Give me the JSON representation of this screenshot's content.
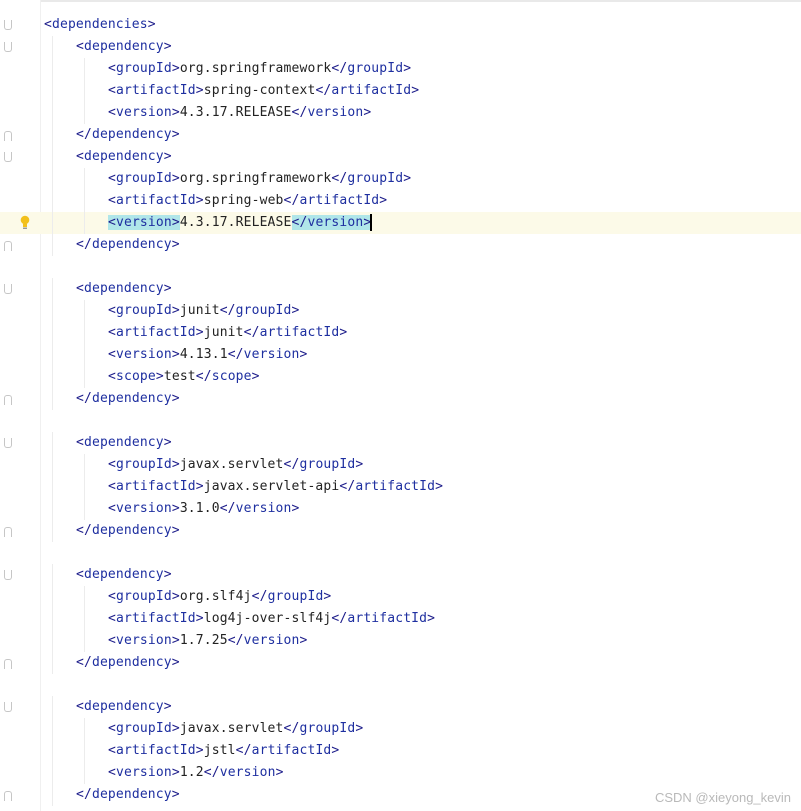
{
  "editor": {
    "language": "xml",
    "current_line_index": 9,
    "caret_after": "</version>",
    "highlighted_tag": "version",
    "lines": [
      {
        "indent": 0,
        "parts": [
          [
            "<",
            "ang"
          ],
          [
            "dependencies",
            "tag"
          ],
          [
            ">",
            "ang"
          ]
        ],
        "fold": "start"
      },
      {
        "indent": 1,
        "parts": [
          [
            "<",
            "ang"
          ],
          [
            "dependency",
            "tag"
          ],
          [
            ">",
            "ang"
          ]
        ],
        "fold": "start"
      },
      {
        "indent": 2,
        "parts": [
          [
            "<",
            "ang"
          ],
          [
            "groupId",
            "tag"
          ],
          [
            ">",
            "ang"
          ],
          [
            "org.springframework",
            "txt"
          ],
          [
            "</",
            "ang"
          ],
          [
            "groupId",
            "tag"
          ],
          [
            ">",
            "ang"
          ]
        ]
      },
      {
        "indent": 2,
        "parts": [
          [
            "<",
            "ang"
          ],
          [
            "artifactId",
            "tag"
          ],
          [
            ">",
            "ang"
          ],
          [
            "spring-context",
            "txt"
          ],
          [
            "</",
            "ang"
          ],
          [
            "artifactId",
            "tag"
          ],
          [
            ">",
            "ang"
          ]
        ]
      },
      {
        "indent": 2,
        "parts": [
          [
            "<",
            "ang"
          ],
          [
            "version",
            "tag"
          ],
          [
            ">",
            "ang"
          ],
          [
            "4.3.17.RELEASE",
            "txt"
          ],
          [
            "</",
            "ang"
          ],
          [
            "version",
            "tag"
          ],
          [
            ">",
            "ang"
          ]
        ]
      },
      {
        "indent": 1,
        "parts": [
          [
            "</",
            "ang"
          ],
          [
            "dependency",
            "tag"
          ],
          [
            ">",
            "ang"
          ]
        ],
        "fold": "end"
      },
      {
        "indent": 1,
        "parts": [
          [
            "<",
            "ang"
          ],
          [
            "dependency",
            "tag"
          ],
          [
            ">",
            "ang"
          ]
        ],
        "fold": "start"
      },
      {
        "indent": 2,
        "parts": [
          [
            "<",
            "ang"
          ],
          [
            "groupId",
            "tag"
          ],
          [
            ">",
            "ang"
          ],
          [
            "org.springframework",
            "txt"
          ],
          [
            "</",
            "ang"
          ],
          [
            "groupId",
            "tag"
          ],
          [
            ">",
            "ang"
          ]
        ]
      },
      {
        "indent": 2,
        "parts": [
          [
            "<",
            "ang"
          ],
          [
            "artifactId",
            "tag"
          ],
          [
            ">",
            "ang"
          ],
          [
            "spring-web",
            "txt"
          ],
          [
            "</",
            "ang"
          ],
          [
            "artifactId",
            "tag"
          ],
          [
            ">",
            "ang"
          ]
        ]
      },
      {
        "indent": 2,
        "parts": [
          [
            "<",
            "ang hl"
          ],
          [
            "version",
            "tag hl"
          ],
          [
            ">",
            "ang hl"
          ],
          [
            "4.3.17.RELEASE",
            "txt"
          ],
          [
            "</",
            "ang hl"
          ],
          [
            "version",
            "tag hl"
          ],
          [
            ">",
            "ang hl"
          ]
        ],
        "current": true,
        "bulb": true
      },
      {
        "indent": 1,
        "parts": [
          [
            "</",
            "ang"
          ],
          [
            "dependency",
            "tag"
          ],
          [
            ">",
            "ang"
          ]
        ],
        "fold": "end"
      },
      {
        "indent": 0,
        "parts": []
      },
      {
        "indent": 1,
        "parts": [
          [
            "<",
            "ang"
          ],
          [
            "dependency",
            "tag"
          ],
          [
            ">",
            "ang"
          ]
        ],
        "fold": "start"
      },
      {
        "indent": 2,
        "parts": [
          [
            "<",
            "ang"
          ],
          [
            "groupId",
            "tag"
          ],
          [
            ">",
            "ang"
          ],
          [
            "junit",
            "txt"
          ],
          [
            "</",
            "ang"
          ],
          [
            "groupId",
            "tag"
          ],
          [
            ">",
            "ang"
          ]
        ]
      },
      {
        "indent": 2,
        "parts": [
          [
            "<",
            "ang"
          ],
          [
            "artifactId",
            "tag"
          ],
          [
            ">",
            "ang"
          ],
          [
            "junit",
            "txt"
          ],
          [
            "</",
            "ang"
          ],
          [
            "artifactId",
            "tag"
          ],
          [
            ">",
            "ang"
          ]
        ]
      },
      {
        "indent": 2,
        "parts": [
          [
            "<",
            "ang"
          ],
          [
            "version",
            "tag"
          ],
          [
            ">",
            "ang"
          ],
          [
            "4.13.1",
            "txt"
          ],
          [
            "</",
            "ang"
          ],
          [
            "version",
            "tag"
          ],
          [
            ">",
            "ang"
          ]
        ]
      },
      {
        "indent": 2,
        "parts": [
          [
            "<",
            "ang"
          ],
          [
            "scope",
            "tag"
          ],
          [
            ">",
            "ang"
          ],
          [
            "test",
            "txt"
          ],
          [
            "</",
            "ang"
          ],
          [
            "scope",
            "tag"
          ],
          [
            ">",
            "ang"
          ]
        ]
      },
      {
        "indent": 1,
        "parts": [
          [
            "</",
            "ang"
          ],
          [
            "dependency",
            "tag"
          ],
          [
            ">",
            "ang"
          ]
        ],
        "fold": "end"
      },
      {
        "indent": 0,
        "parts": []
      },
      {
        "indent": 1,
        "parts": [
          [
            "<",
            "ang"
          ],
          [
            "dependency",
            "tag"
          ],
          [
            ">",
            "ang"
          ]
        ],
        "fold": "start"
      },
      {
        "indent": 2,
        "parts": [
          [
            "<",
            "ang"
          ],
          [
            "groupId",
            "tag"
          ],
          [
            ">",
            "ang"
          ],
          [
            "javax.servlet",
            "txt"
          ],
          [
            "</",
            "ang"
          ],
          [
            "groupId",
            "tag"
          ],
          [
            ">",
            "ang"
          ]
        ]
      },
      {
        "indent": 2,
        "parts": [
          [
            "<",
            "ang"
          ],
          [
            "artifactId",
            "tag"
          ],
          [
            ">",
            "ang"
          ],
          [
            "javax.servlet-api",
            "txt"
          ],
          [
            "</",
            "ang"
          ],
          [
            "artifactId",
            "tag"
          ],
          [
            ">",
            "ang"
          ]
        ]
      },
      {
        "indent": 2,
        "parts": [
          [
            "<",
            "ang"
          ],
          [
            "version",
            "tag"
          ],
          [
            ">",
            "ang"
          ],
          [
            "3.1.0",
            "txt"
          ],
          [
            "</",
            "ang"
          ],
          [
            "version",
            "tag"
          ],
          [
            ">",
            "ang"
          ]
        ]
      },
      {
        "indent": 1,
        "parts": [
          [
            "</",
            "ang"
          ],
          [
            "dependency",
            "tag"
          ],
          [
            ">",
            "ang"
          ]
        ],
        "fold": "end"
      },
      {
        "indent": 0,
        "parts": []
      },
      {
        "indent": 1,
        "parts": [
          [
            "<",
            "ang"
          ],
          [
            "dependency",
            "tag"
          ],
          [
            ">",
            "ang"
          ]
        ],
        "fold": "start"
      },
      {
        "indent": 2,
        "parts": [
          [
            "<",
            "ang"
          ],
          [
            "groupId",
            "tag"
          ],
          [
            ">",
            "ang"
          ],
          [
            "org.slf4j",
            "txt"
          ],
          [
            "</",
            "ang"
          ],
          [
            "groupId",
            "tag"
          ],
          [
            ">",
            "ang"
          ]
        ]
      },
      {
        "indent": 2,
        "parts": [
          [
            "<",
            "ang"
          ],
          [
            "artifactId",
            "tag"
          ],
          [
            ">",
            "ang"
          ],
          [
            "log4j-over-slf4j",
            "txt"
          ],
          [
            "</",
            "ang"
          ],
          [
            "artifactId",
            "tag"
          ],
          [
            ">",
            "ang"
          ]
        ]
      },
      {
        "indent": 2,
        "parts": [
          [
            "<",
            "ang"
          ],
          [
            "version",
            "tag"
          ],
          [
            ">",
            "ang"
          ],
          [
            "1.7.25",
            "txt"
          ],
          [
            "</",
            "ang"
          ],
          [
            "version",
            "tag"
          ],
          [
            ">",
            "ang"
          ]
        ]
      },
      {
        "indent": 1,
        "parts": [
          [
            "</",
            "ang"
          ],
          [
            "dependency",
            "tag"
          ],
          [
            ">",
            "ang"
          ]
        ],
        "fold": "end"
      },
      {
        "indent": 0,
        "parts": []
      },
      {
        "indent": 1,
        "parts": [
          [
            "<",
            "ang"
          ],
          [
            "dependency",
            "tag"
          ],
          [
            ">",
            "ang"
          ]
        ],
        "fold": "start"
      },
      {
        "indent": 2,
        "parts": [
          [
            "<",
            "ang"
          ],
          [
            "groupId",
            "tag"
          ],
          [
            ">",
            "ang"
          ],
          [
            "javax.servlet",
            "txt"
          ],
          [
            "</",
            "ang"
          ],
          [
            "groupId",
            "tag"
          ],
          [
            ">",
            "ang"
          ]
        ]
      },
      {
        "indent": 2,
        "parts": [
          [
            "<",
            "ang"
          ],
          [
            "artifactId",
            "tag"
          ],
          [
            ">",
            "ang"
          ],
          [
            "jstl",
            "txt"
          ],
          [
            "</",
            "ang"
          ],
          [
            "artifactId",
            "tag"
          ],
          [
            ">",
            "ang"
          ]
        ]
      },
      {
        "indent": 2,
        "parts": [
          [
            "<",
            "ang"
          ],
          [
            "version",
            "tag"
          ],
          [
            ">",
            "ang"
          ],
          [
            "1.2",
            "txt"
          ],
          [
            "</",
            "ang"
          ],
          [
            "version",
            "tag"
          ],
          [
            ">",
            "ang"
          ]
        ]
      },
      {
        "indent": 1,
        "parts": [
          [
            "</",
            "ang"
          ],
          [
            "dependency",
            "tag"
          ],
          [
            ">",
            "ang"
          ]
        ],
        "fold": "end"
      }
    ]
  },
  "icons": {
    "intention_bulb": "lightbulb-icon",
    "fold_marker": "fold-marker-icon"
  },
  "colors": {
    "tag": "#1e2fa0",
    "text": "#222222",
    "current_line_bg": "#fcfae8",
    "tag_match_bg": "#b0e6e9",
    "bulb": "#f2c01c"
  },
  "watermark": "CSDN @xieyong_kevin"
}
